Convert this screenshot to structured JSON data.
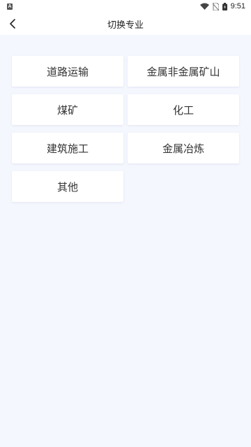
{
  "status_bar": {
    "app_badge": "A",
    "time": "9:51"
  },
  "header": {
    "title": "切换专业"
  },
  "options": [
    {
      "label": "道路运输"
    },
    {
      "label": "金属非金属矿山"
    },
    {
      "label": "煤矿"
    },
    {
      "label": "化工"
    },
    {
      "label": "建筑施工"
    },
    {
      "label": "金属冶炼"
    },
    {
      "label": "其他"
    }
  ]
}
